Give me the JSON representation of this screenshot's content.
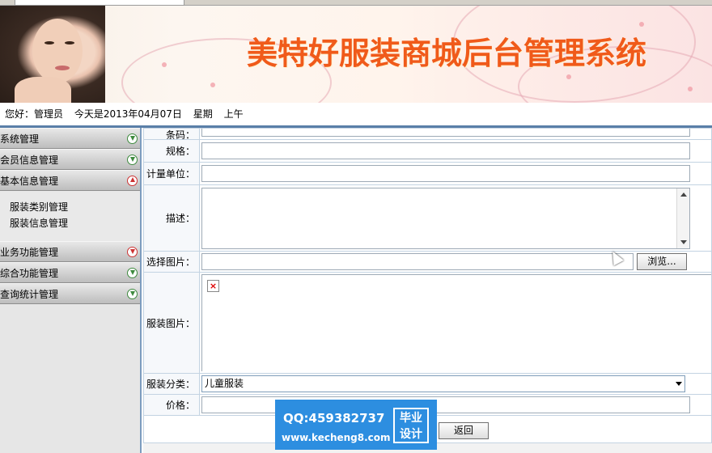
{
  "banner": {
    "title": "美特好服装商城后台管理系统"
  },
  "infobar": {
    "greeting": "您好：管理员",
    "date": "今天是2013年04月07日",
    "weekday": "星期",
    "period": "上午"
  },
  "sidebar": {
    "menus": [
      {
        "label": "系统管理"
      },
      {
        "label": "会员信息管理"
      },
      {
        "label": "基本信息管理",
        "sub": [
          "服装类别管理",
          "服装信息管理"
        ]
      },
      {
        "label": "业务功能管理"
      },
      {
        "label": "综合功能管理"
      },
      {
        "label": "查询统计管理"
      }
    ]
  },
  "form": {
    "barcode_label": "条码：",
    "spec_label": "规格：",
    "unit_label": "计量单位：",
    "desc_label": "描述：",
    "choose_image_label": "选择图片：",
    "browse_button": "浏览...",
    "image_label": "服装图片：",
    "category_label": "服装分类：",
    "category_value": "儿童服装",
    "price_label": "价格：",
    "back_button": "返回"
  },
  "watermark": {
    "qq": "QQ:459382737",
    "site": "www.kecheng8.com",
    "logo_line1": "毕业",
    "logo_line2": "设计"
  }
}
